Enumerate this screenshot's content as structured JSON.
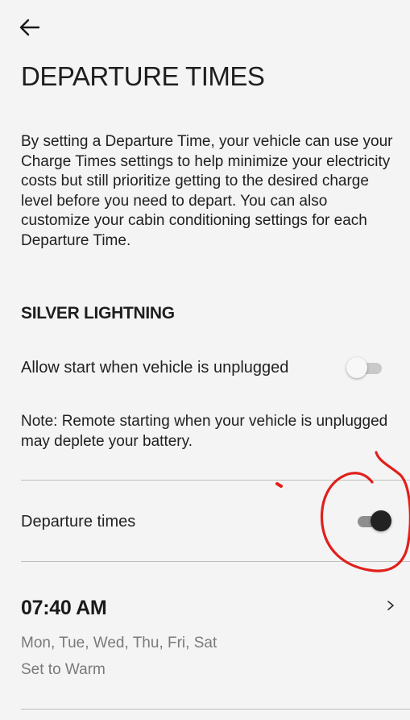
{
  "header": {
    "back_icon": "arrow-left-icon",
    "title": "DEPARTURE TIMES"
  },
  "description": "By setting a Departure Time, your vehicle can use your Charge Times settings to help minimize your electricity costs but still prioritize getting to the desired charge level before you need to depart. You can also customize your cabin conditioning settings for each Departure Time.",
  "vehicle": {
    "name": "SILVER LIGHTNING"
  },
  "settings": {
    "allow_unplugged": {
      "label": "Allow start when vehicle is unplugged",
      "enabled": false
    },
    "note": "Note: Remote starting when your vehicle is unplugged may deplete your battery.",
    "departure_times": {
      "label": "Departure times",
      "enabled": true
    }
  },
  "schedules": [
    {
      "time": "07:40 AM",
      "days": "Mon, Tue, Wed, Thu, Fri, Sat",
      "mode": "Set to Warm",
      "chevron_icon": "chevron-right-icon"
    }
  ],
  "colors": {
    "background": "#f4f4f4",
    "toggle_on_knob": "#222222",
    "toggle_off_knob": "#f7f7f7",
    "secondary_text": "#7a7a7a",
    "annotation": "#e0201c"
  }
}
